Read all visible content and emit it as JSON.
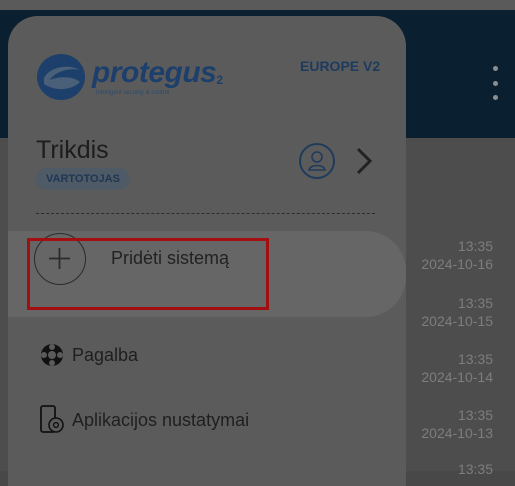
{
  "drawer": {
    "brand": {
      "name": "protegus",
      "suffix": "2",
      "tagline": "Intelligent security & control"
    },
    "region": "EUROPE V2",
    "user": {
      "name": "Trikdis",
      "role": "VARTOTOJAS"
    },
    "add_system_label": "Pridėti sistemą",
    "menu": [
      {
        "label": "Pagalba",
        "icon": "lifebuoy-icon"
      },
      {
        "label": "Aplikacijos nustatymai",
        "icon": "phone-settings-icon"
      }
    ]
  },
  "background_list": [
    {
      "time": "13:35",
      "date": "2024-10-16"
    },
    {
      "time": "13:35",
      "date": "2024-10-15"
    },
    {
      "time": "13:35",
      "date": "2024-10-14"
    },
    {
      "time": "13:35",
      "date": "2024-10-13"
    },
    {
      "time": "13:35",
      "date": ""
    }
  ],
  "colors": {
    "highlight": "#a30f10",
    "brand": "#1d3f6b"
  }
}
